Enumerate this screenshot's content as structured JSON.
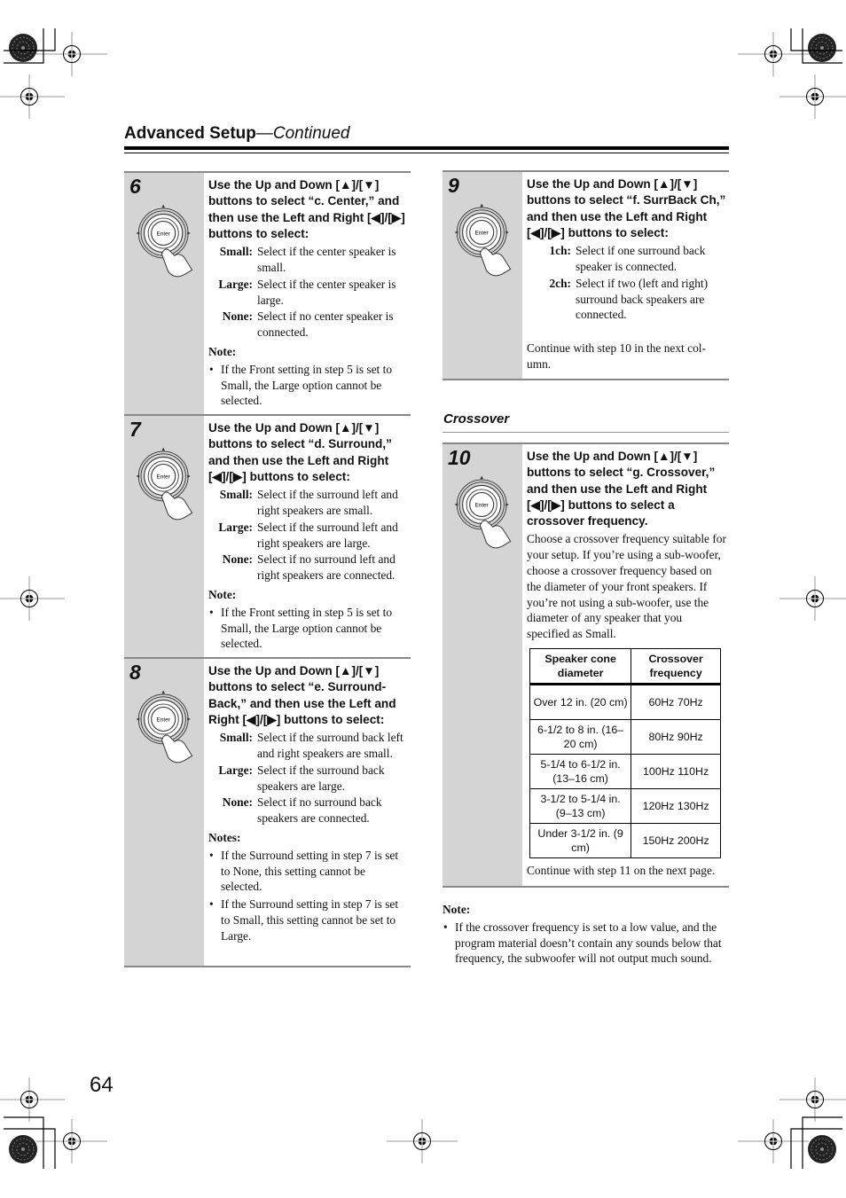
{
  "header": {
    "title": "Advanced Setup",
    "continued": "—Continued"
  },
  "page_number": "64",
  "icons": {
    "dial": "enter-dial-with-hand-icon",
    "registration": "registration-mark-icon",
    "color_target": "print-color-target-icon"
  },
  "dial_label": "Enter",
  "steps": [
    {
      "number": "6",
      "instruction": "Use the Up and Down [▲]/[▼] buttons to select “c. Center,” and then use the Left and Right [◀]/[▶] buttons to select:",
      "options": [
        {
          "key": "Small:",
          "text": "Select if the center speaker is small."
        },
        {
          "key": "Large:",
          "text": "Select if the center speaker is large."
        },
        {
          "key": "None:",
          "text": "Select if no center speaker is connected."
        }
      ],
      "note_heading": "Note:",
      "notes": [
        "If the Front setting in step 5 is set to Small, the Large option cannot be selected."
      ]
    },
    {
      "number": "7",
      "instruction": "Use the Up and Down [▲]/[▼] buttons to select “d. Surround,” and then use the Left and Right [◀]/[▶] buttons to select:",
      "options": [
        {
          "key": "Small:",
          "text": "Select if the surround left and right speakers are small."
        },
        {
          "key": "Large:",
          "text": "Select if the surround left and right speakers are large."
        },
        {
          "key": "None:",
          "text": "Select if no surround left and right speakers are connected."
        }
      ],
      "note_heading": "Note:",
      "notes": [
        "If the Front setting in step 5 is set to Small, the Large option cannot be selected."
      ]
    },
    {
      "number": "8",
      "instruction": "Use the Up and Down [▲]/[▼] buttons to select “e. Surround-Back,” and then use the Left and Right [◀]/[▶] buttons to select:",
      "options": [
        {
          "key": "Small:",
          "text": "Select if the surround back left and right speakers are small."
        },
        {
          "key": "Large:",
          "text": "Select if the surround back speakers are large."
        },
        {
          "key": "None:",
          "text": "Select if no surround back speakers are connected."
        }
      ],
      "note_heading": "Notes:",
      "notes": [
        "If the Surround setting in step 7 is set to None, this setting cannot be selected.",
        "If the Surround setting in step 7 is set to Small, this setting cannot be set to Large."
      ]
    },
    {
      "number": "9",
      "instruction": "Use the Up and Down [▲]/[▼] buttons to select “f. SurrBack Ch,” and then use the Left and Right [◀]/[▶] buttons to select:",
      "options": [
        {
          "key": "1ch:",
          "text": "Select if one surround back speaker is connected."
        },
        {
          "key": "2ch:",
          "text": "Select if two (left and right) surround back speakers are connected."
        }
      ],
      "continue": "Continue with step 10 in the next col-umn."
    },
    {
      "number": "10",
      "instruction": "Use the Up and Down [▲]/[▼] buttons to select “g. Crossover,” and then use the Left and Right [◀]/[▶] buttons to select a crossover frequency.",
      "body": "Choose a crossover frequency suitable for your setup. If you’re using a sub-woofer, choose a crossover frequency based on the diameter of your front speakers. If you’re not using a sub-woofer, use the diameter of any speaker that you specified as Small.",
      "table": {
        "headers": [
          "Speaker cone diameter",
          "Crossover frequency"
        ],
        "rows": [
          [
            "Over 12 in. (20 cm)",
            "60Hz 70Hz"
          ],
          [
            "6-1/2 to 8 in. (16–20 cm)",
            "80Hz 90Hz"
          ],
          [
            "5-1/4 to 6-1/2 in. (13–16 cm)",
            "100Hz 110Hz"
          ],
          [
            "3-1/2 to 5-1/4 in. (9–13 cm)",
            "120Hz 130Hz"
          ],
          [
            "Under 3-1/2 in. (9 cm)",
            "150Hz 200Hz"
          ]
        ]
      },
      "continue": "Continue with step 11 on the next page."
    }
  ],
  "section": {
    "crossover_heading": "Crossover"
  },
  "bottom_note": {
    "heading": "Note:",
    "text": "If the crossover frequency is set to a low value, and the program material doesn’t contain any sounds below that frequency, the subwoofer will not output much sound."
  }
}
